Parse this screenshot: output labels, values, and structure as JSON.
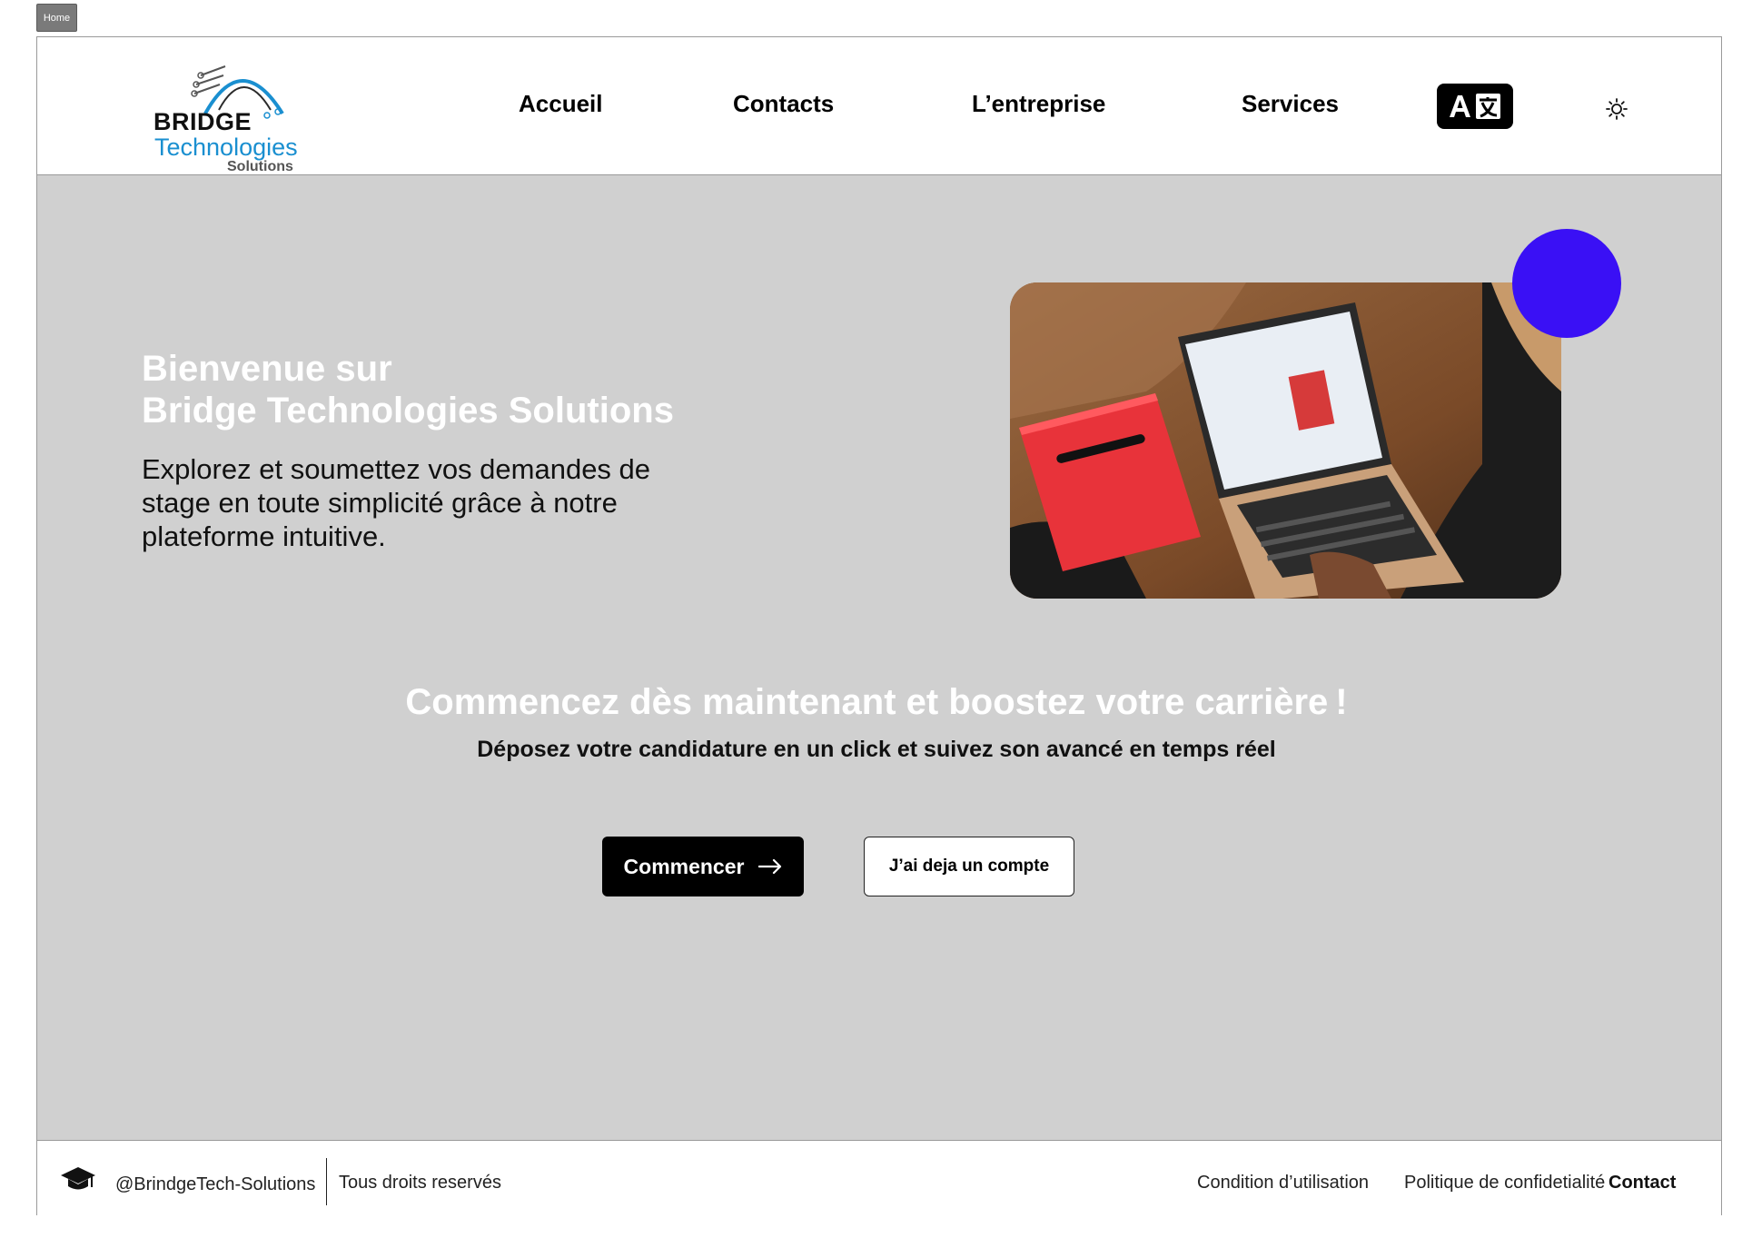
{
  "page_tag": "Home",
  "logo": {
    "line1": "BRIDGE",
    "line2": "Technologies",
    "line3": "Solutions",
    "accent_color": "#1a8fd0"
  },
  "nav": {
    "items": [
      {
        "label": "Accueil"
      },
      {
        "label": "Contacts"
      },
      {
        "label": "L’entreprise"
      },
      {
        "label": "Services"
      }
    ],
    "translate_icon": "translate-icon",
    "theme_icon": "sun-icon"
  },
  "hero": {
    "title_line1": "Bienvenue sur",
    "title_line2": "Bridge Technologies Solutions",
    "description": "Explorez et soumettez vos demandes de stage en toute simplicité grâce à notre plateforme intuitive.",
    "background_color": "#d0d0d0",
    "accent_dot_color": "#3a10f5"
  },
  "cta": {
    "title": "Commencez dès maintenant et boostez votre carrière !",
    "subtitle": "Déposez votre candidature en un click et suivez son avancé en temps réel",
    "primary_label": "Commencer",
    "secondary_label": "J’ai deja un compte"
  },
  "footer": {
    "icon": "graduation-cap-icon",
    "handle": "@BrindgeTech-Solutions",
    "rights": "Tous droits reservés",
    "links": [
      {
        "label": "Condition d’utilisation"
      },
      {
        "label": "Politique de confidetialité"
      },
      {
        "label": "Contact"
      }
    ]
  }
}
